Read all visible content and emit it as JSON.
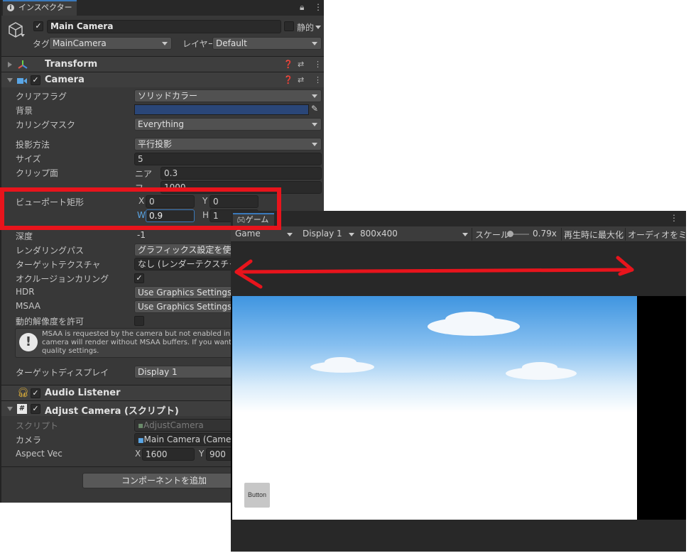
{
  "inspector": {
    "tab_label": "インスペクター",
    "object": {
      "name": "Main Camera",
      "static_label": "静的",
      "tag_label": "タグ",
      "tag_value": "MainCamera",
      "layer_label": "レイヤー",
      "layer_value": "Default"
    },
    "transform": {
      "title": "Transform"
    },
    "camera": {
      "title": "Camera",
      "clear_flags_label": "クリアフラグ",
      "clear_flags_value": "ソリッドカラー",
      "background_label": "背景",
      "background_color": "#2a4678",
      "culling_mask_label": "カリングマスク",
      "culling_mask_value": "Everything",
      "projection_label": "投影方法",
      "projection_value": "平行投影",
      "size_label": "サイズ",
      "size_value": "5",
      "clip_label": "クリップ面",
      "near_label": "ニア",
      "near_value": "0.3",
      "far_label": "フ",
      "far_value": "1000",
      "viewport_label": "ビューポート矩形",
      "vx_label": "X",
      "vx_value": "0",
      "vy_label": "Y",
      "vy_value": "0",
      "vw_label": "W",
      "vw_value": "0.9",
      "vh_label": "H",
      "vh_value": "1",
      "depth_label": "深度",
      "depth_value": "-1",
      "render_path_label": "レンダリングパス",
      "render_path_value": "グラフィックス設定を使用",
      "target_texture_label": "ターゲットテクスチャ",
      "target_texture_value": "なし (レンダーテクスチャ)",
      "occlusion_label": "オクルージョンカリング",
      "hdr_label": "HDR",
      "hdr_value": "Use Graphics Settings",
      "msaa_label": "MSAA",
      "msaa_value": "Use Graphics Settings",
      "dynamic_res_label": "動的解像度を許可",
      "warning_line1": "MSAA is requested by the camera but not enabled in qu",
      "warning_line2": "camera will render without MSAA buffers. If you want M",
      "warning_line3": "quality settings.",
      "target_display_label": "ターゲットディスプレイ",
      "target_display_value": "Display 1"
    },
    "audio_listener": {
      "title": "Audio Listener"
    },
    "adjust_camera": {
      "title": "Adjust Camera (スクリプト)",
      "script_label": "スクリプト",
      "script_value": "AdjustCamera",
      "camera_label": "カメラ",
      "camera_value": "Main Camera (Camer",
      "aspect_label": "Aspect Vec",
      "ax_label": "X",
      "ax_value": "1600",
      "ay_label": "Y",
      "ay_value": "900"
    },
    "add_component_label": "コンポーネントを追加"
  },
  "game": {
    "tab_label": "ゲーム",
    "view_mode": "Game",
    "display": "Display 1",
    "resolution": "800x400",
    "scale_label": "スケール",
    "scale_value": "0.79x",
    "maximize_label": "再生時に最大化",
    "audio_label": "オーディオをミュー",
    "scene_button_label": "Button"
  },
  "colors": {
    "highlight_box": "#e8141c",
    "arrow": "#e8141c",
    "accent": "#3a79bb"
  }
}
